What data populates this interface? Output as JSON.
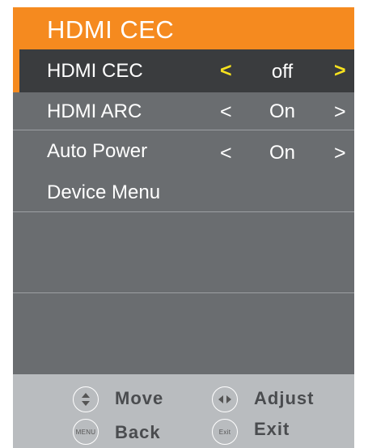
{
  "title": "HDMI CEC",
  "items": [
    {
      "label": "HDMI CEC",
      "left_arrow": "<",
      "value": "off",
      "right_arrow": ">",
      "selected": true
    },
    {
      "label": "HDMI ARC",
      "left_arrow": "<",
      "value": "On",
      "right_arrow": ">",
      "selected": false
    },
    {
      "label": "Auto Power",
      "left_arrow": "<",
      "value": "On",
      "right_arrow": ">",
      "selected": false
    },
    {
      "label": "Device Menu",
      "selected": false
    }
  ],
  "footer": {
    "move": {
      "icon": "up-down-arrows-icon",
      "label": "Move"
    },
    "adjust": {
      "icon": "left-right-arrows-icon",
      "label": "Adjust"
    },
    "back": {
      "icon": "menu-button-icon",
      "icon_text": "MENU",
      "label": "Back"
    },
    "exit": {
      "icon": "exit-button-icon",
      "icon_text": "Exit",
      "label": "Exit"
    }
  },
  "colors": {
    "title_bar": "#f58a1f",
    "panel": "#6a6d70",
    "selected_row": "#3a3c3e",
    "selected_arrows": "#f7e21e",
    "footer": "#b9bcbf"
  }
}
